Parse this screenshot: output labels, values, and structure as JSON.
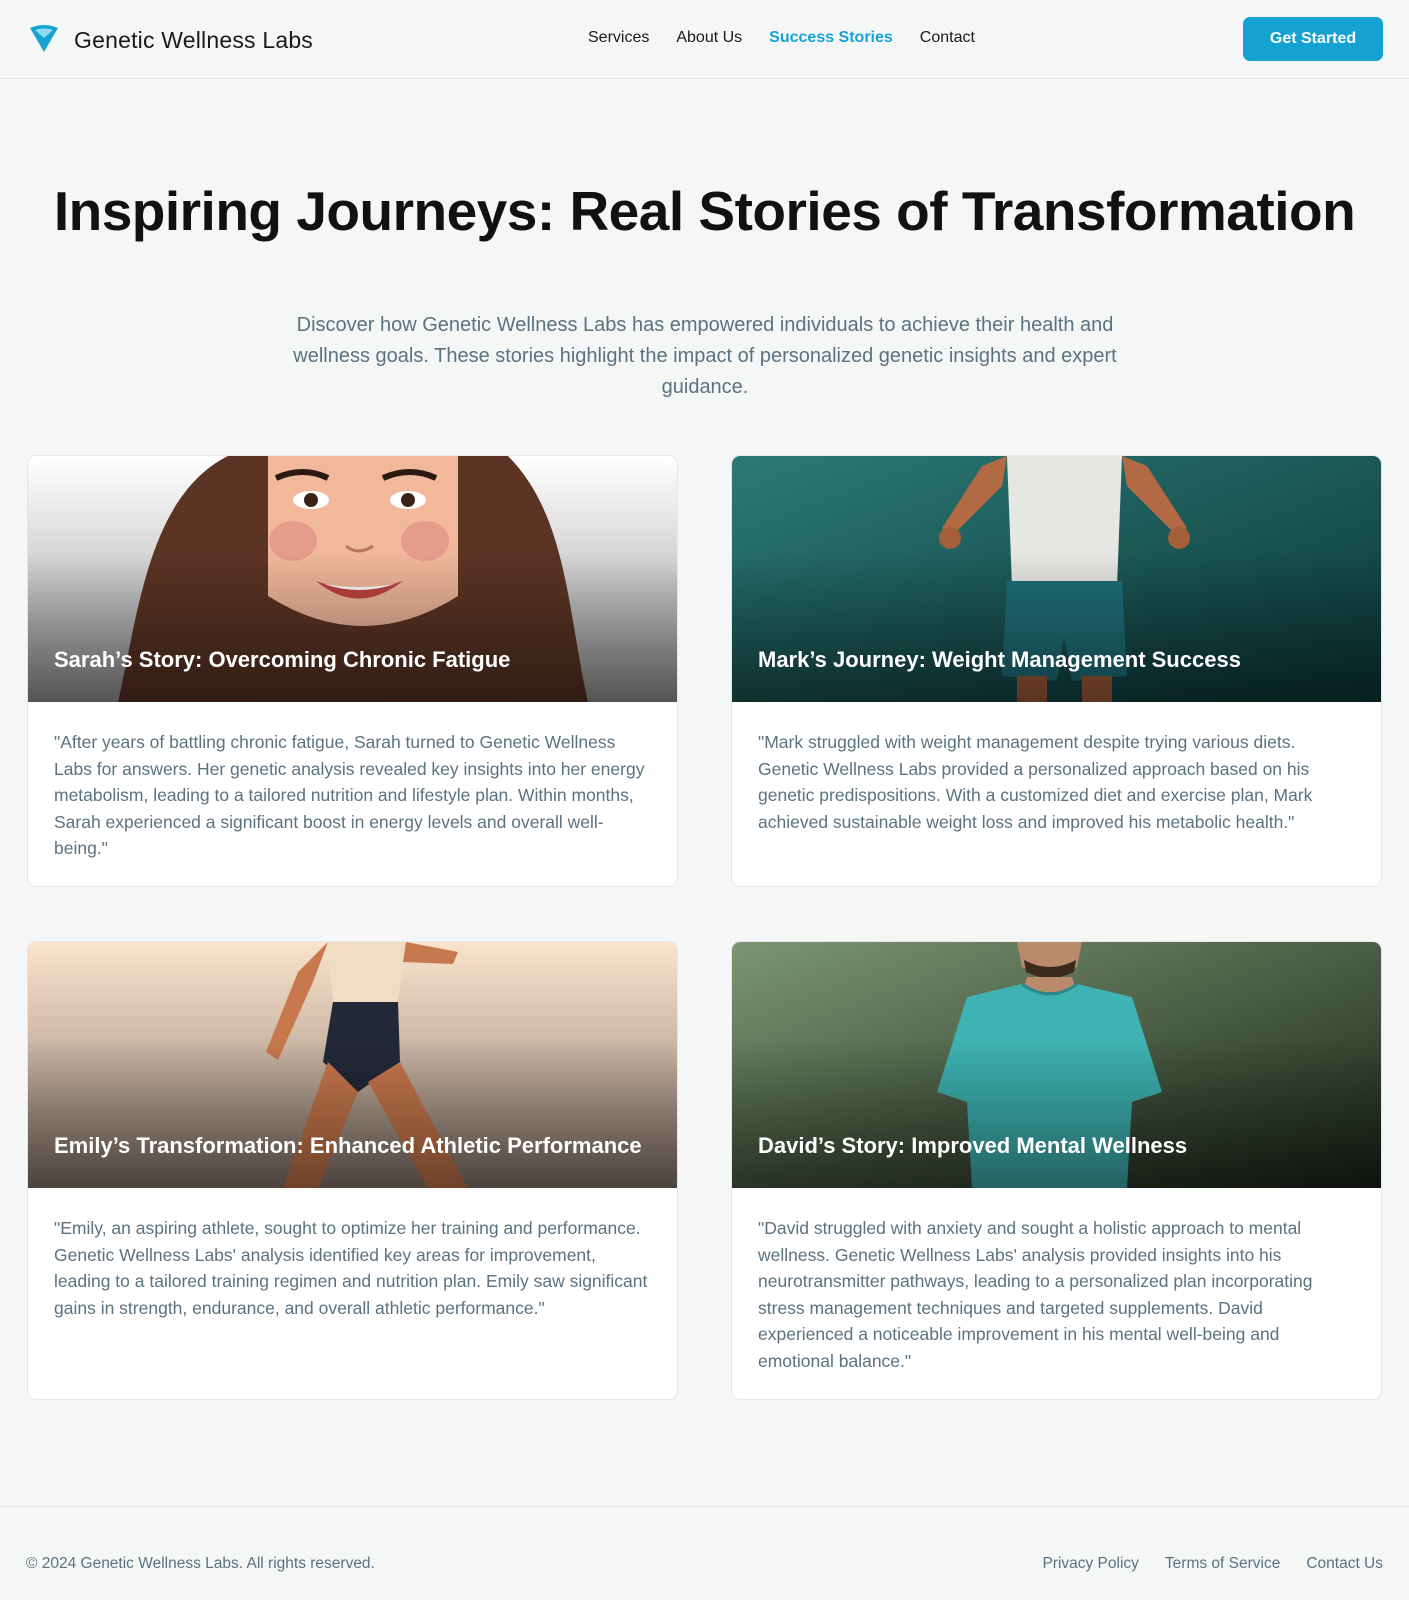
{
  "header": {
    "brand": "Genetic Wellness Labs",
    "nav": [
      "Services",
      "About Us",
      "Success Stories",
      "Contact"
    ],
    "active_nav": "Success Stories",
    "cta": "Get Started"
  },
  "hero": {
    "title": "Inspiring Journeys: Real Stories of Transformation",
    "subtitle": "Discover how Genetic Wellness Labs has empowered individuals to achieve their health and wellness goals. These stories highlight the impact of personalized genetic insights and expert guidance."
  },
  "stories": [
    {
      "title": "Sarah’s Story: Overcoming Chronic Fatigue",
      "quote": "\"After years of battling chronic fatigue, Sarah turned to Genetic Wellness Labs for answers. Her genetic analysis revealed key insights into her energy metabolism, leading to a tailored nutrition and lifestyle plan. Within months, Sarah experienced a significant boost in energy levels and overall well-being.\""
    },
    {
      "title": "Mark’s Journey: Weight Management Success",
      "quote": "\"Mark struggled with weight management despite trying various diets. Genetic Wellness Labs provided a personalized approach based on his genetic predispositions. With a customized diet and exercise plan, Mark achieved sustainable weight loss and improved his metabolic health.\""
    },
    {
      "title": "Emily’s Transformation: Enhanced Athletic Performance",
      "quote": "\"Emily, an aspiring athlete, sought to optimize her training and performance. Genetic Wellness Labs' analysis identified key areas for improvement, leading to a tailored training regimen and nutrition plan. Emily saw significant gains in strength, endurance, and overall athletic performance.\""
    },
    {
      "title": "David’s Story: Improved Mental Wellness",
      "quote": "\"David struggled with anxiety and sought a holistic approach to mental wellness. Genetic Wellness Labs' analysis provided insights into his neurotransmitter pathways, leading to a personalized plan incorporating stress management techniques and targeted supplements. David experienced a noticeable improvement in his mental well-being and emotional balance.\""
    }
  ],
  "footer": {
    "copyright": "© 2024 Genetic Wellness Labs. All rights reserved.",
    "links": [
      "Privacy Policy",
      "Terms of Service",
      "Contact Us"
    ]
  },
  "colors": {
    "accent": "#15a2d2",
    "text_muted": "#5b7280",
    "background": "#f5f7f7"
  }
}
